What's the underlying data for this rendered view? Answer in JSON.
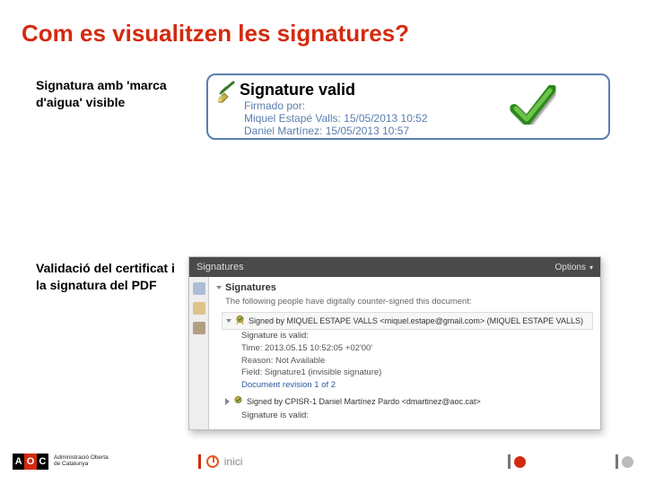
{
  "title": "Com es visualitzen les signatures?",
  "section1": {
    "label": "Signatura amb 'marca d'aigua' visible",
    "box": {
      "title": "Signature valid",
      "signed_by": "Firmado por:",
      "signer1": "Miquel Estapé Valls: 15/05/2013 10:52",
      "signer2": "Daniel Martínez: 15/05/2013 10:57"
    }
  },
  "section2": {
    "label": "Validació del certificat i la signatura del PDF",
    "panel": {
      "header_title": "Signatures",
      "header_options": "Options",
      "heading": "Signatures",
      "help": "The following people have digitally counter-signed this document:",
      "signed_by_1": "Signed by MIQUEL ESTAPE VALLS <miquel.estape@gmail.com> (MIQUEL ESTAPE VALLS)",
      "valid": "Signature is valid:",
      "time": "Time: 2013.05.15 10:52:05 +02'00'",
      "reason": "Reason: Not Available",
      "field": "Field: Signature1 (invisible signature)",
      "revision": "Document revision 1 of 2",
      "signed_by_2": "Signed by CPISR-1 Daniel Martínez Pardo <dmartinez@aoc.cat>",
      "valid2": "Signature is valid:"
    }
  },
  "footer": {
    "logo": {
      "a": "A",
      "o": "O",
      "c": "C",
      "text1": "Administració Oberta",
      "text2": "de Catalunya"
    },
    "inici": "inici"
  }
}
